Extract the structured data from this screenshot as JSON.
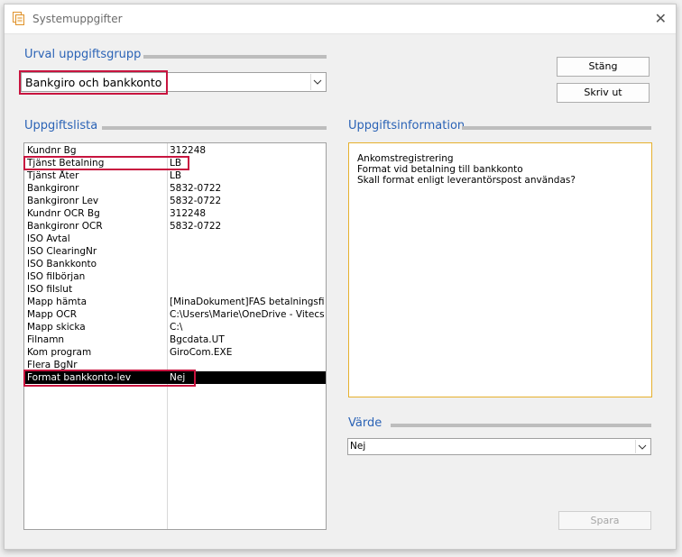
{
  "window": {
    "title": "Systemuppgifter",
    "app_icon": "document-stack-icon",
    "close_glyph": "✕"
  },
  "urval": {
    "label": "Urval uppgiftsgrupp",
    "selected": "Bankgiro och bankkonto"
  },
  "buttons": {
    "close": "Stäng",
    "print": "Skriv ut",
    "save": "Spara"
  },
  "list": {
    "label": "Uppgiftslista",
    "rows": [
      {
        "key": "Kundnr Bg",
        "value": "312248"
      },
      {
        "key": "Tjänst Betalning",
        "value": "LB"
      },
      {
        "key": "Tjänst Åter",
        "value": "LB"
      },
      {
        "key": "Bankgironr",
        "value": "5832-0722"
      },
      {
        "key": "Bankgironr Lev",
        "value": "5832-0722"
      },
      {
        "key": "Kundnr OCR Bg",
        "value": "312248"
      },
      {
        "key": "Bankgironr OCR",
        "value": "5832-0722"
      },
      {
        "key": "ISO Avtal",
        "value": ""
      },
      {
        "key": "ISO ClearingNr",
        "value": ""
      },
      {
        "key": "ISO Bankkonto",
        "value": ""
      },
      {
        "key": "ISO filbörjan",
        "value": ""
      },
      {
        "key": "ISO filslut",
        "value": ""
      },
      {
        "key": "Mapp hämta",
        "value": "[MinaDokument]FAS betalningsfiler\\I"
      },
      {
        "key": "Mapp OCR",
        "value": "C:\\Users\\Marie\\OneDrive - Vitecsoft"
      },
      {
        "key": "Mapp skicka",
        "value": "C:\\"
      },
      {
        "key": "Filnamn",
        "value": "Bgcdata.UT"
      },
      {
        "key": "Kom program",
        "value": "GiroCom.EXE"
      },
      {
        "key": "Flera BgNr",
        "value": ""
      },
      {
        "key": "Format bankkonto-lev",
        "value": "Nej"
      }
    ]
  },
  "info": {
    "label": "Uppgiftsinformation",
    "lines": [
      "Ankomstregistrering",
      "Format vid betalning till bankkonto",
      "Skall format enligt leverantörspost användas?"
    ]
  },
  "varde": {
    "label": "Värde",
    "selected": "Nej"
  },
  "colors": {
    "group_label": "#2b63b6",
    "highlight": "#c8143f",
    "info_border": "#e6b02d",
    "selected_row": "#000000"
  }
}
